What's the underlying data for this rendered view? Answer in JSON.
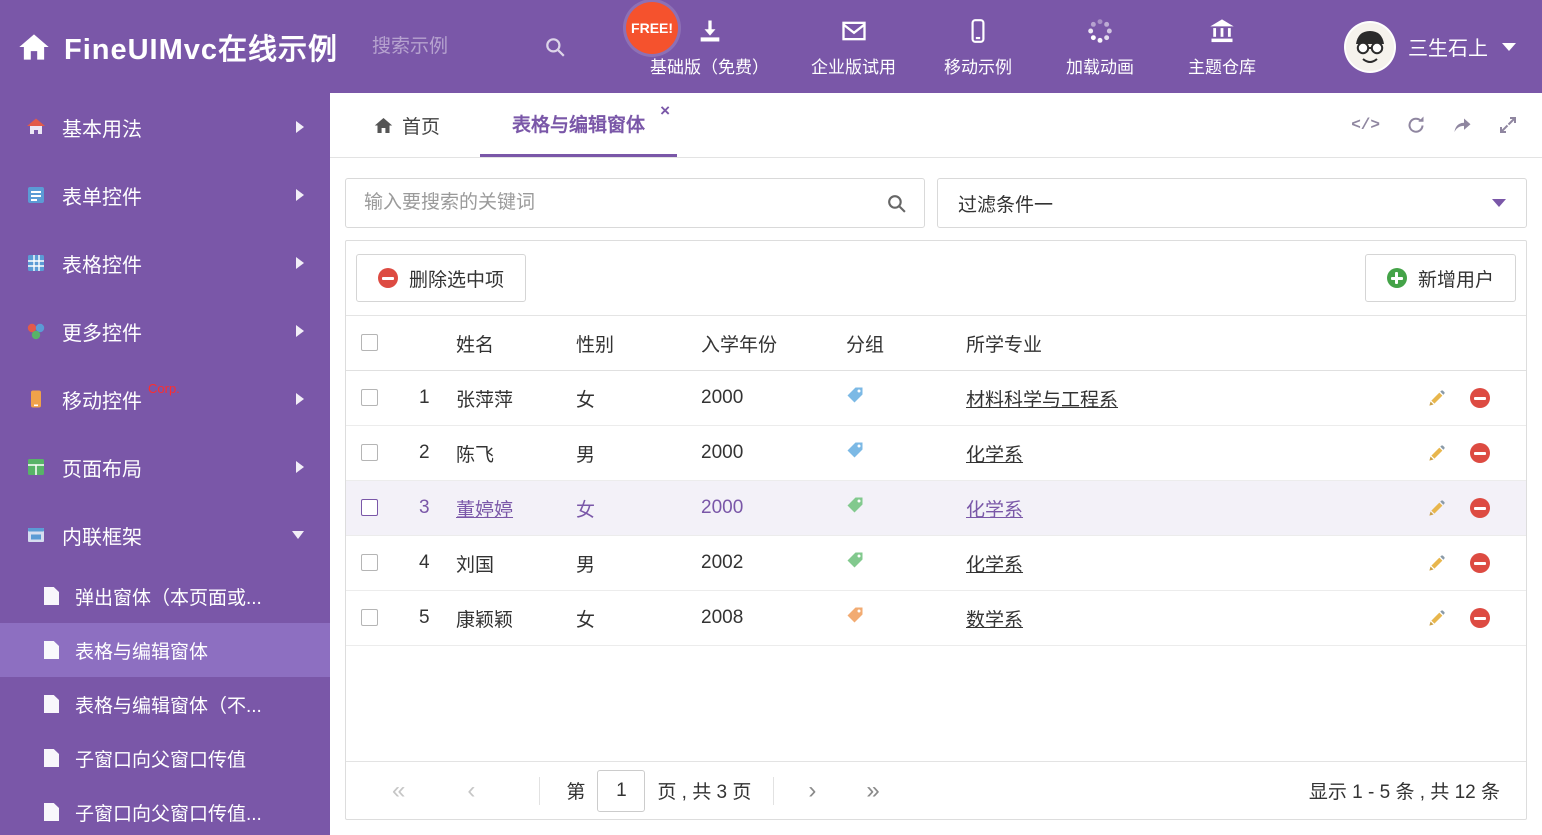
{
  "colors": {
    "brand_purple": "#7a57a8",
    "sidebar_selected": "#8d6fc1",
    "selected_row_bg": "#f3f1f8",
    "accent_red": "#dd4b42",
    "accent_green": "#44a348",
    "free_badge": "#f5522d",
    "corp_red": "#ff2d2d",
    "tag_blue": "#7cb9e5",
    "tag_green": "#82c98e",
    "tag_orange": "#f2ab72",
    "pencil_gold": "#e0a843"
  },
  "header": {
    "title": "FineUIMvc在线示例",
    "search_placeholder": "搜索示例",
    "free_badge": "FREE!",
    "nav": [
      {
        "label": "基础版（免费）",
        "icon": "download-icon"
      },
      {
        "label": "企业版试用",
        "icon": "envelope-icon"
      },
      {
        "label": "移动示例",
        "icon": "mobile-icon"
      },
      {
        "label": "加载动画",
        "icon": "spinner-icon"
      },
      {
        "label": "主题仓库",
        "icon": "bank-icon"
      }
    ],
    "user": {
      "name": "三生石上"
    }
  },
  "sidebar": {
    "items": [
      {
        "label": "基本用法",
        "icon": "home-icon"
      },
      {
        "label": "表单控件",
        "icon": "form-icon"
      },
      {
        "label": "表格控件",
        "icon": "grid-icon"
      },
      {
        "label": "更多控件",
        "icon": "more-icon"
      },
      {
        "label": "移动控件",
        "icon": "mobile-icon",
        "badge": "Corp."
      },
      {
        "label": "页面布局",
        "icon": "layout-icon"
      },
      {
        "label": "内联框架",
        "icon": "iframe-icon",
        "expanded": true
      }
    ],
    "subitems": [
      {
        "label": "弹出窗体（本页面或...",
        "active": false
      },
      {
        "label": "表格与编辑窗体",
        "active": true
      },
      {
        "label": "表格与编辑窗体（不...",
        "active": false
      },
      {
        "label": "子窗口向父窗口传值",
        "active": false
      },
      {
        "label": "子窗口向父窗口传值...",
        "active": false
      }
    ]
  },
  "tabs": {
    "home_label": "首页",
    "active_label": "表格与编辑窗体",
    "close_glyph": "×",
    "code_glyph": "</>"
  },
  "filter": {
    "search_placeholder": "输入要搜索的关键词",
    "dropdown_value": "过滤条件一"
  },
  "toolbar": {
    "delete_label": "删除选中项",
    "add_label": "新增用户"
  },
  "table": {
    "columns": {
      "name": "姓名",
      "gender": "性别",
      "year": "入学年份",
      "group": "分组",
      "major": "所学专业"
    },
    "rows": [
      {
        "index": "1",
        "name": "张萍萍",
        "gender": "女",
        "year": "2000",
        "tag": "blue",
        "major": "材料科学与工程系",
        "selected": false
      },
      {
        "index": "2",
        "name": "陈飞",
        "gender": "男",
        "year": "2000",
        "tag": "blue",
        "major": "化学系",
        "selected": false
      },
      {
        "index": "3",
        "name": "董婷婷",
        "gender": "女",
        "year": "2000",
        "tag": "green",
        "major": "化学系",
        "selected": true
      },
      {
        "index": "4",
        "name": "刘国",
        "gender": "男",
        "year": "2002",
        "tag": "green",
        "major": "化学系",
        "selected": false
      },
      {
        "index": "5",
        "name": "康颖颖",
        "gender": "女",
        "year": "2008",
        "tag": "orange",
        "major": "数学系",
        "selected": false
      }
    ]
  },
  "pagination": {
    "first_glyph": "«",
    "prev_glyph": "‹",
    "next_glyph": "›",
    "last_glyph": "»",
    "prefix": "第",
    "page_value": "1",
    "suffix": "页 , 共 3 页",
    "summary": "显示 1 - 5 条 , 共 12 条"
  }
}
